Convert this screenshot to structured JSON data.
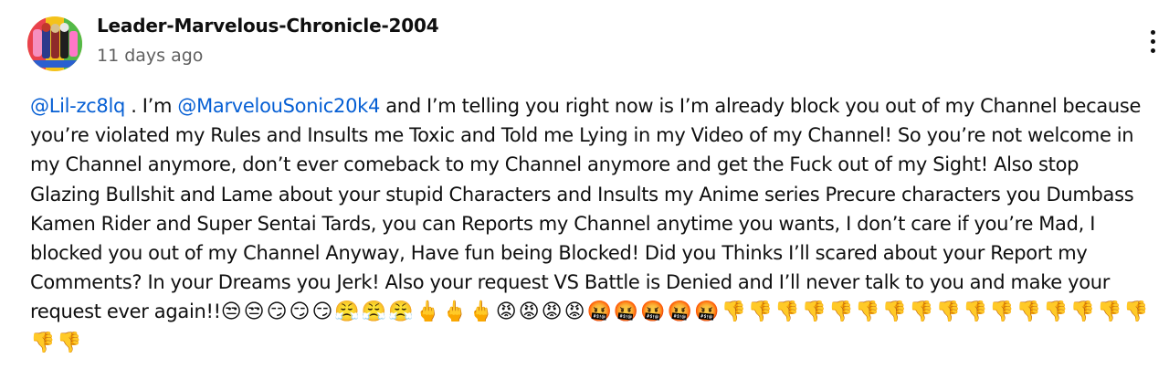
{
  "comment": {
    "author": "Leader-Marvelous-Chronicle-2004",
    "timestamp": "11 days ago",
    "mention_1": "@Lil-zc8lq",
    "text_1": " . I’m ",
    "mention_2": "@MarvelouSonic20k4",
    "text_2": "  and I’m telling you right now is I’m already block you out of my Channel because you’re violated my Rules and Insults me Toxic and Told me Lying in my Video of my Channel! So you’re not welcome in my Channel anymore, don’t ever comeback to my Channel anymore and get the Fuck out of my Sight! Also stop Glazing Bullshit and Lame about your stupid Characters and Insults my Anime series Precure characters you Dumbass Kamen Rider and Super Sentai Tards, you can Reports my Channel anytime you wants, I don’t care if you’re Mad, I blocked you out of my Channel Anyway, Have fun being Blocked! Did you Thinks I’ll scared about your Report my Comments? In your Dreams you Jerk! Also your request VS Battle is Denied and I’ll never talk to you and make your request ever again!!",
    "emojis": "😒😒😏😏😏😤😤😤🖕🖕🖕😡😡😡😡🤬🤬🤬🤬🤬👎👎👎👎👎👎👎👎👎👎👎👎👎👎👎👎👎👎"
  },
  "icons": {
    "avatar": "avatar-image",
    "menu": "more-vertical-icon"
  },
  "colors": {
    "mention": "#065fd4",
    "timestamp": "#606060",
    "text": "#0f0f0f"
  }
}
